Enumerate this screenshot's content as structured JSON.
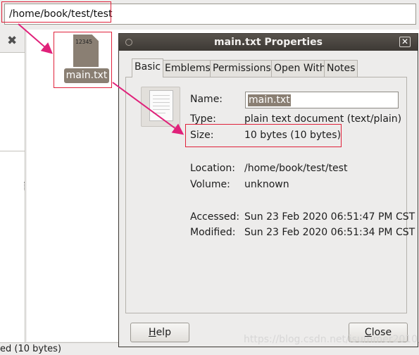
{
  "file_manager": {
    "location_path": "/home/book/test/test",
    "close_pane_glyph": "✖",
    "file": {
      "name": "main.txt",
      "preview_text": "12345"
    },
    "status_text": "ed (10 bytes)"
  },
  "dialog": {
    "title": "main.txt Properties",
    "close_glyph": "✕",
    "tabs": [
      {
        "label": "Basic",
        "active": true
      },
      {
        "label": "Emblems",
        "active": false
      },
      {
        "label": "Permissions",
        "active": false
      },
      {
        "label": "Open With",
        "active": false
      },
      {
        "label": "Notes",
        "active": false
      }
    ],
    "basic": {
      "name_label": "Name:",
      "name_value": "main.txt",
      "type_label": "Type:",
      "type_value": "plain text document (text/plain)",
      "size_label": "Size:",
      "size_value": "10 bytes (10 bytes)",
      "location_label": "Location:",
      "location_value": "/home/book/test/test",
      "volume_label": "Volume:",
      "volume_value": "unknown",
      "accessed_label": "Accessed:",
      "accessed_value": "Sun 23 Feb 2020 06:51:47 PM CST",
      "modified_label": "Modified:",
      "modified_value": "Sun 23 Feb 2020 06:51:34 PM CST"
    },
    "buttons": {
      "help_mnemonic": "H",
      "help_rest": "elp",
      "close_mnemonic": "C",
      "close_rest": "lose"
    }
  },
  "watermark": "https://blog.csdn.net/isummer2010",
  "colors": {
    "annotation_outline": "#e0213a",
    "annotation_arrow": "#e0217a",
    "selection": "#8a7f73",
    "titlebar": "#3d3935"
  },
  "icons": {
    "file_icon": "text-file-icon",
    "document_preview": "document-icon",
    "close_pane": "close-icon",
    "dialog_close": "close-icon"
  }
}
